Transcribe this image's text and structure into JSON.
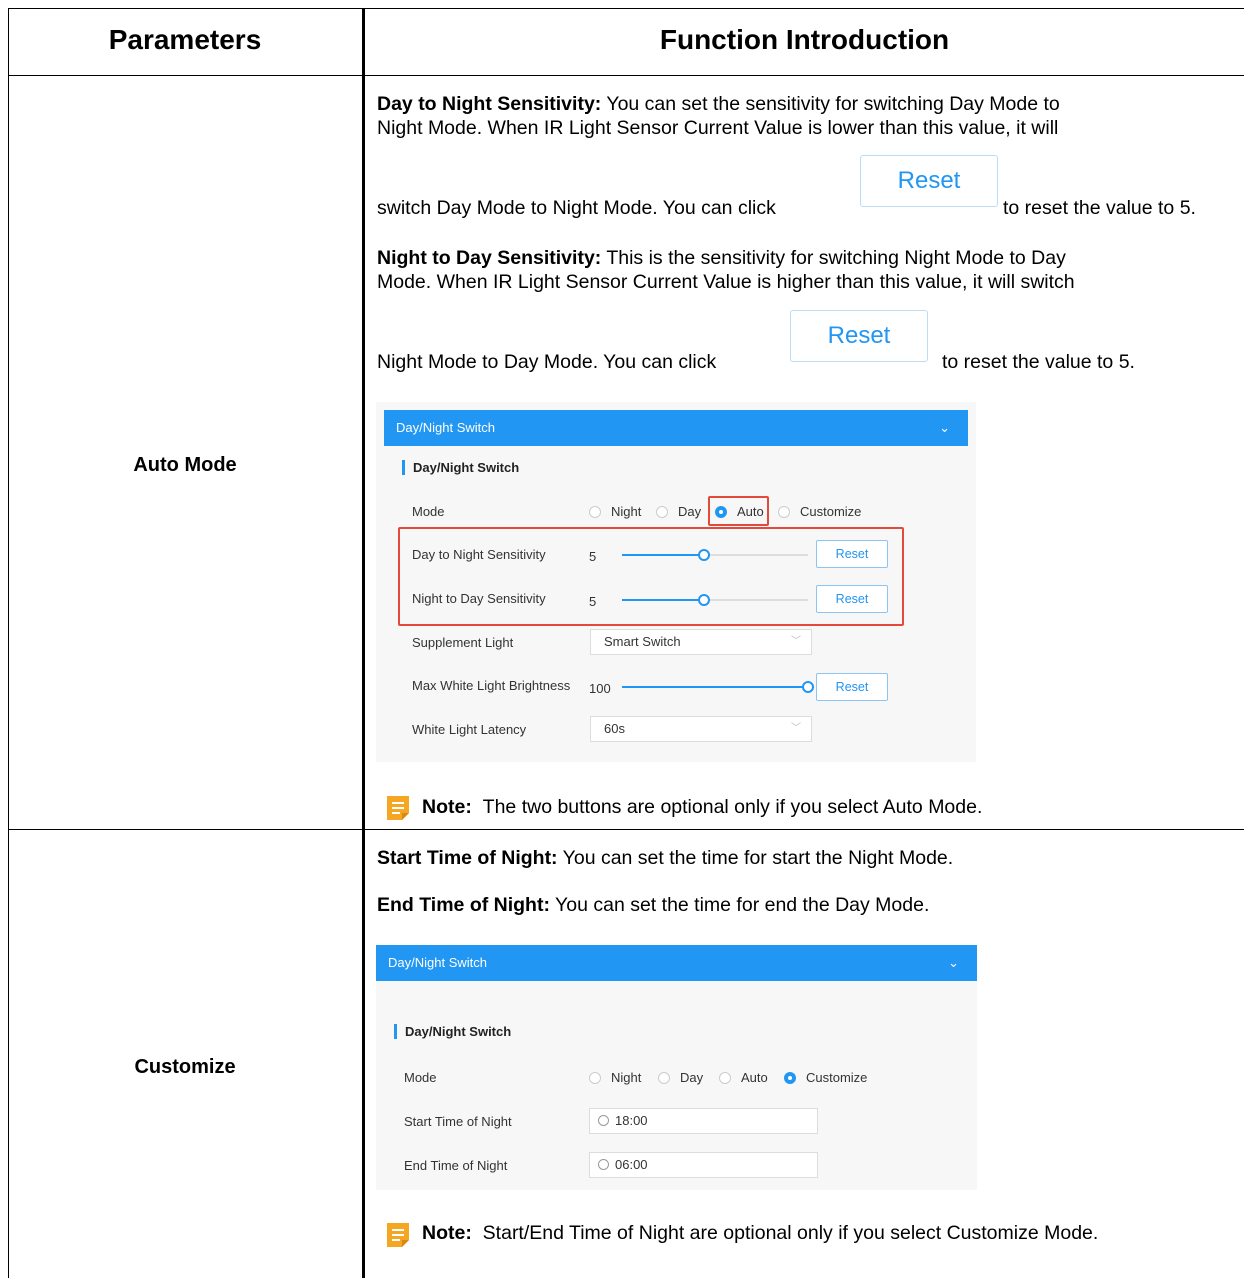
{
  "headers": {
    "parameters": "Parameters",
    "function": "Function Introduction"
  },
  "rows": [
    {
      "param": "Auto Mode",
      "p1_bold": "Day to Night Sensitivity:",
      "p1_line1": " You can set the sensitivity for switching Day Mode to",
      "p1_line2": "Night Mode. When IR Light Sensor Current Value is lower than this value, it will",
      "p1_line3a": "switch Day Mode to Night Mode. You can click",
      "p1_line3b": "to reset the value to 5.",
      "p2_bold": "Night to Day Sensitivity:",
      "p2_line1": " This is the sensitivity for switching Night Mode to Day",
      "p2_line2": "Mode. When IR Light Sensor Current Value is higher than this value, it will switch",
      "p2_line3a": "Night Mode to Day Mode. You can click",
      "p2_line3b": "to reset the value to 5.",
      "reset_big": "Reset",
      "note_label": "Note:",
      "note_text": "The two buttons are optional only if you select Auto Mode."
    },
    {
      "param": "Customize",
      "p1_bold": "Start Time of Night:",
      "p1_text": " You can set the time for start the Night Mode.",
      "p2_bold": "End Time of Night:",
      "p2_text": " You can set the time for end the Day Mode.",
      "note_label": "Note:",
      "note_text": "Start/End Time of Night are optional only if you select Customize Mode."
    }
  ],
  "panel1": {
    "bar_title": "Day/Night Switch",
    "section": "Day/Night Switch",
    "mode_label": "Mode",
    "mode_options": [
      "Night",
      "Day",
      "Auto",
      "Customize"
    ],
    "mode_selected": "Auto",
    "d2n_label": "Day to Night Sensitivity",
    "d2n_value": "5",
    "n2d_label": "Night to Day Sensitivity",
    "n2d_value": "5",
    "supp_label": "Supplement Light",
    "supp_value": "Smart Switch",
    "max_label": "Max White Light Brightness",
    "max_value": "100",
    "latency_label": "White Light Latency",
    "latency_value": "60s",
    "reset": "Reset"
  },
  "panel2": {
    "bar_title": "Day/Night Switch",
    "section": "Day/Night Switch",
    "mode_label": "Mode",
    "mode_options": [
      "Night",
      "Day",
      "Auto",
      "Customize"
    ],
    "mode_selected": "Customize",
    "start_label": "Start Time of Night",
    "start_value": "18:00",
    "end_label": "End Time of Night",
    "end_value": "06:00"
  },
  "colors": {
    "accent": "#2196f3",
    "highlight": "#e24a3b",
    "note_icon": "#f5a623"
  },
  "icons": {
    "chevron": "chevron-down-icon",
    "clock": "clock-icon",
    "note": "note-icon"
  }
}
